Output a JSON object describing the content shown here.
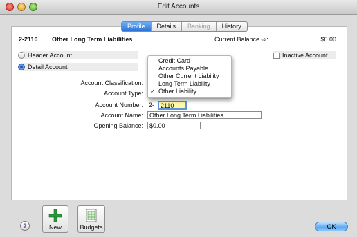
{
  "window": {
    "title": "Edit Accounts"
  },
  "tabs": [
    {
      "label": "Profile",
      "state": "active"
    },
    {
      "label": "Details",
      "state": "normal"
    },
    {
      "label": "Banking",
      "state": "disabled"
    },
    {
      "label": "History",
      "state": "normal"
    }
  ],
  "header": {
    "account_number": "2-2110",
    "account_name": "Other Long Term Liabilities",
    "current_balance_label": "Current Balance ⇨:",
    "current_balance_value": "$0.00"
  },
  "options": {
    "header_account_label": "Header Account",
    "detail_account_label": "Detail Account",
    "selected": "Detail Account",
    "inactive_account_label": "Inactive Account",
    "inactive_checked": false
  },
  "form": {
    "classification_label": "Account Classification:",
    "type_label": "Account Type:",
    "number_label": "Account Number:",
    "number_prefix": "2-",
    "number_value": "2110",
    "name_label": "Account Name:",
    "name_value": "Other Long Term Liabilities",
    "opening_balance_label": "Opening Balance:",
    "opening_balance_value": "$0.00"
  },
  "account_type_menu": {
    "items": [
      "Credit Card",
      "Accounts Payable",
      "Other Current Liability",
      "Long Term Liability",
      "Other Liability"
    ],
    "selected": "Other Liability",
    "check_glyph": "✓"
  },
  "toolbar": {
    "new_label": "New",
    "budgets_label": "Budgets",
    "help_label": "?",
    "ok_label": "OK"
  },
  "icons": {
    "new": "green-plus-icon",
    "budgets": "spreadsheet-icon",
    "help": "question-icon"
  }
}
